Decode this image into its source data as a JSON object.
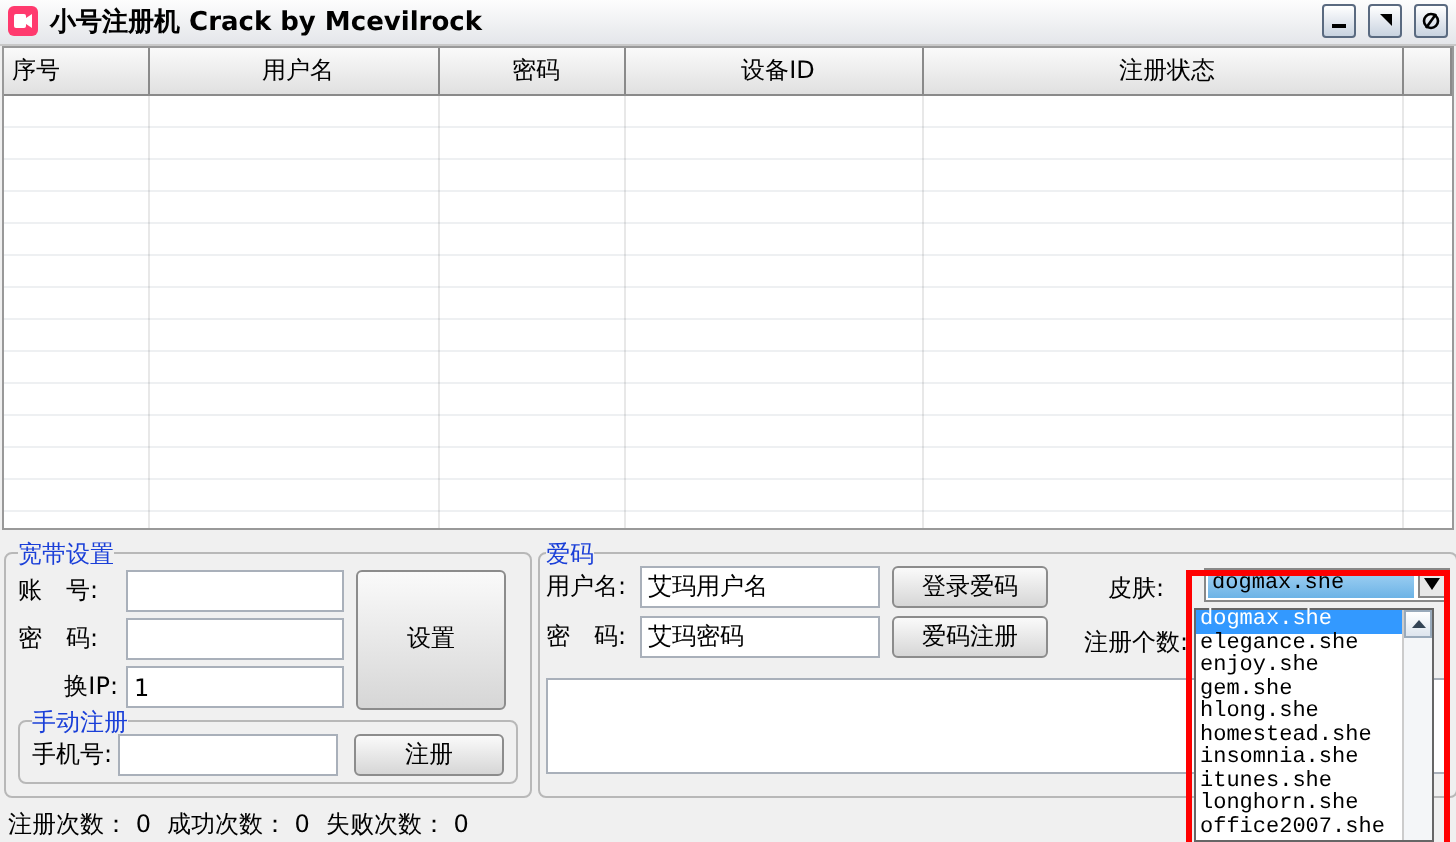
{
  "window": {
    "title": "小号注册机 Crack by Mcevilrock"
  },
  "table": {
    "columns": [
      "序号",
      "用户名",
      "密码",
      "设备ID",
      "注册状态"
    ]
  },
  "broadband": {
    "title": "宽带设置",
    "account_label": "账　号:",
    "password_label": "密　码:",
    "ip_label": "换IP:",
    "ip_value": "1",
    "set_button": "设置"
  },
  "manual": {
    "title": "手动注册",
    "phone_label": "手机号:",
    "register_button": "注册"
  },
  "aima": {
    "title": "爱码",
    "username_label": "用户名:",
    "username_value": "艾玛用户名",
    "password_label": "密　码:",
    "password_value": "艾玛密码",
    "login_button": "登录爱码",
    "register_button": "爱码注册",
    "skin_label": "皮肤:",
    "count_label": "注册个数:",
    "skin": {
      "value": "dogmax.she",
      "expanded": true,
      "options": [
        {
          "label": "dogmax.she",
          "selected": true
        },
        {
          "label": "elegance.she",
          "selected": false
        },
        {
          "label": "enjoy.she",
          "selected": false
        },
        {
          "label": "gem.she",
          "selected": false
        },
        {
          "label": "hlong.she",
          "selected": false
        },
        {
          "label": "homestead.she",
          "selected": false
        },
        {
          "label": "insomnia.she",
          "selected": false
        },
        {
          "label": "itunes.she",
          "selected": false
        },
        {
          "label": "longhorn.she",
          "selected": false
        },
        {
          "label": "office2007.she",
          "selected": false
        }
      ]
    }
  },
  "status": [
    {
      "label": "注册次数：",
      "value": "0"
    },
    {
      "label": "成功次数：",
      "value": "0"
    },
    {
      "label": "失败次数：",
      "value": "0"
    }
  ]
}
